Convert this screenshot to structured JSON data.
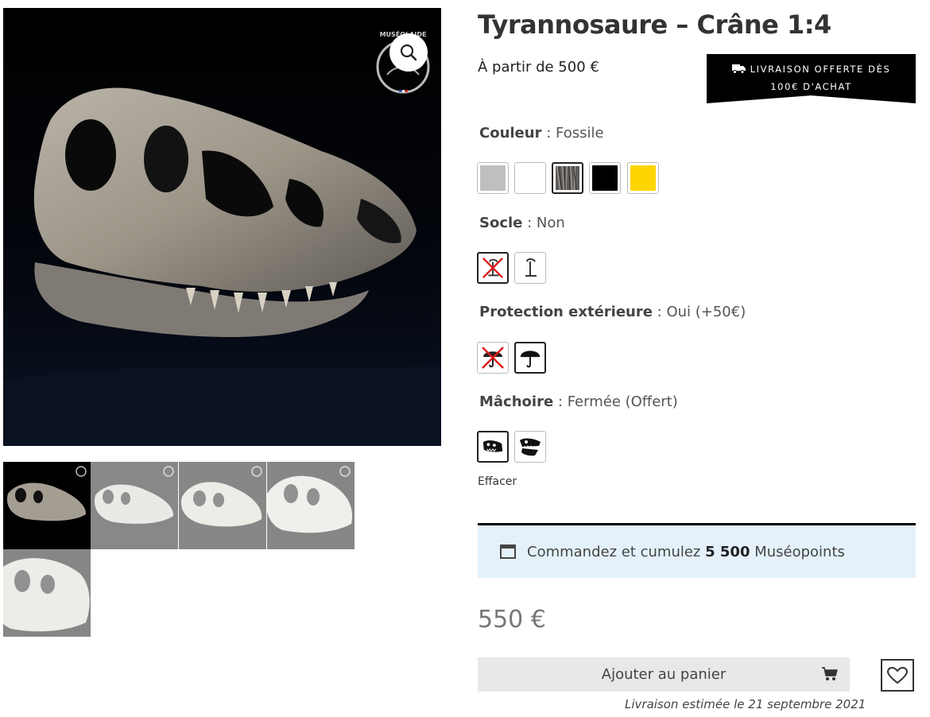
{
  "product": {
    "title": "Tyrannosaure – Crâne 1:4",
    "price_from": "À partir de 500 €",
    "final_price": "550 €"
  },
  "shipping_banner": {
    "line1": "LIVRAISON OFFERTE DÈS",
    "line2": "100€ D'ACHAT",
    "icon": "truck-icon"
  },
  "attributes": {
    "couleur": {
      "name": "Couleur",
      "value": "Fossile",
      "options": [
        {
          "name": "Gris",
          "color": "#bfbfbf",
          "selected": false
        },
        {
          "name": "Blanc",
          "color": "#ffffff",
          "selected": false
        },
        {
          "name": "Fossile",
          "color": "#6e6a66",
          "selected": true
        },
        {
          "name": "Noir",
          "color": "#000000",
          "selected": false
        },
        {
          "name": "Jaune",
          "color": "#ffd500",
          "selected": false
        }
      ]
    },
    "socle": {
      "name": "Socle",
      "value": "Non",
      "options": [
        {
          "icon": "no-stand-icon",
          "selected": true
        },
        {
          "icon": "stand-icon",
          "selected": false
        }
      ]
    },
    "protection": {
      "name": "Protection extérieure",
      "value": "Oui (+50€)",
      "options": [
        {
          "icon": "no-umbrella-icon",
          "selected": false
        },
        {
          "icon": "umbrella-icon",
          "selected": true
        }
      ]
    },
    "machoire": {
      "name": "Mâchoire",
      "value": "Fermée (Offert)",
      "options": [
        {
          "icon": "closed-jaw-icon",
          "selected": true
        },
        {
          "icon": "open-jaw-icon",
          "selected": false
        }
      ]
    },
    "separator": " : "
  },
  "clear_label": "Effacer",
  "points": {
    "prefix": "Commandez et cumulez ",
    "amount": "5 500",
    "suffix": " Muséopoints",
    "icon": "calendar-icon"
  },
  "cart": {
    "label": "Ajouter au panier",
    "icon": "cart-icon"
  },
  "wishlist_icon": "heart-icon",
  "delivery_estimate": "Livraison estimée le 21 septembre 2021",
  "gallery": {
    "zoom_icon": "magnifier-icon",
    "thumbnail_count": 5
  }
}
